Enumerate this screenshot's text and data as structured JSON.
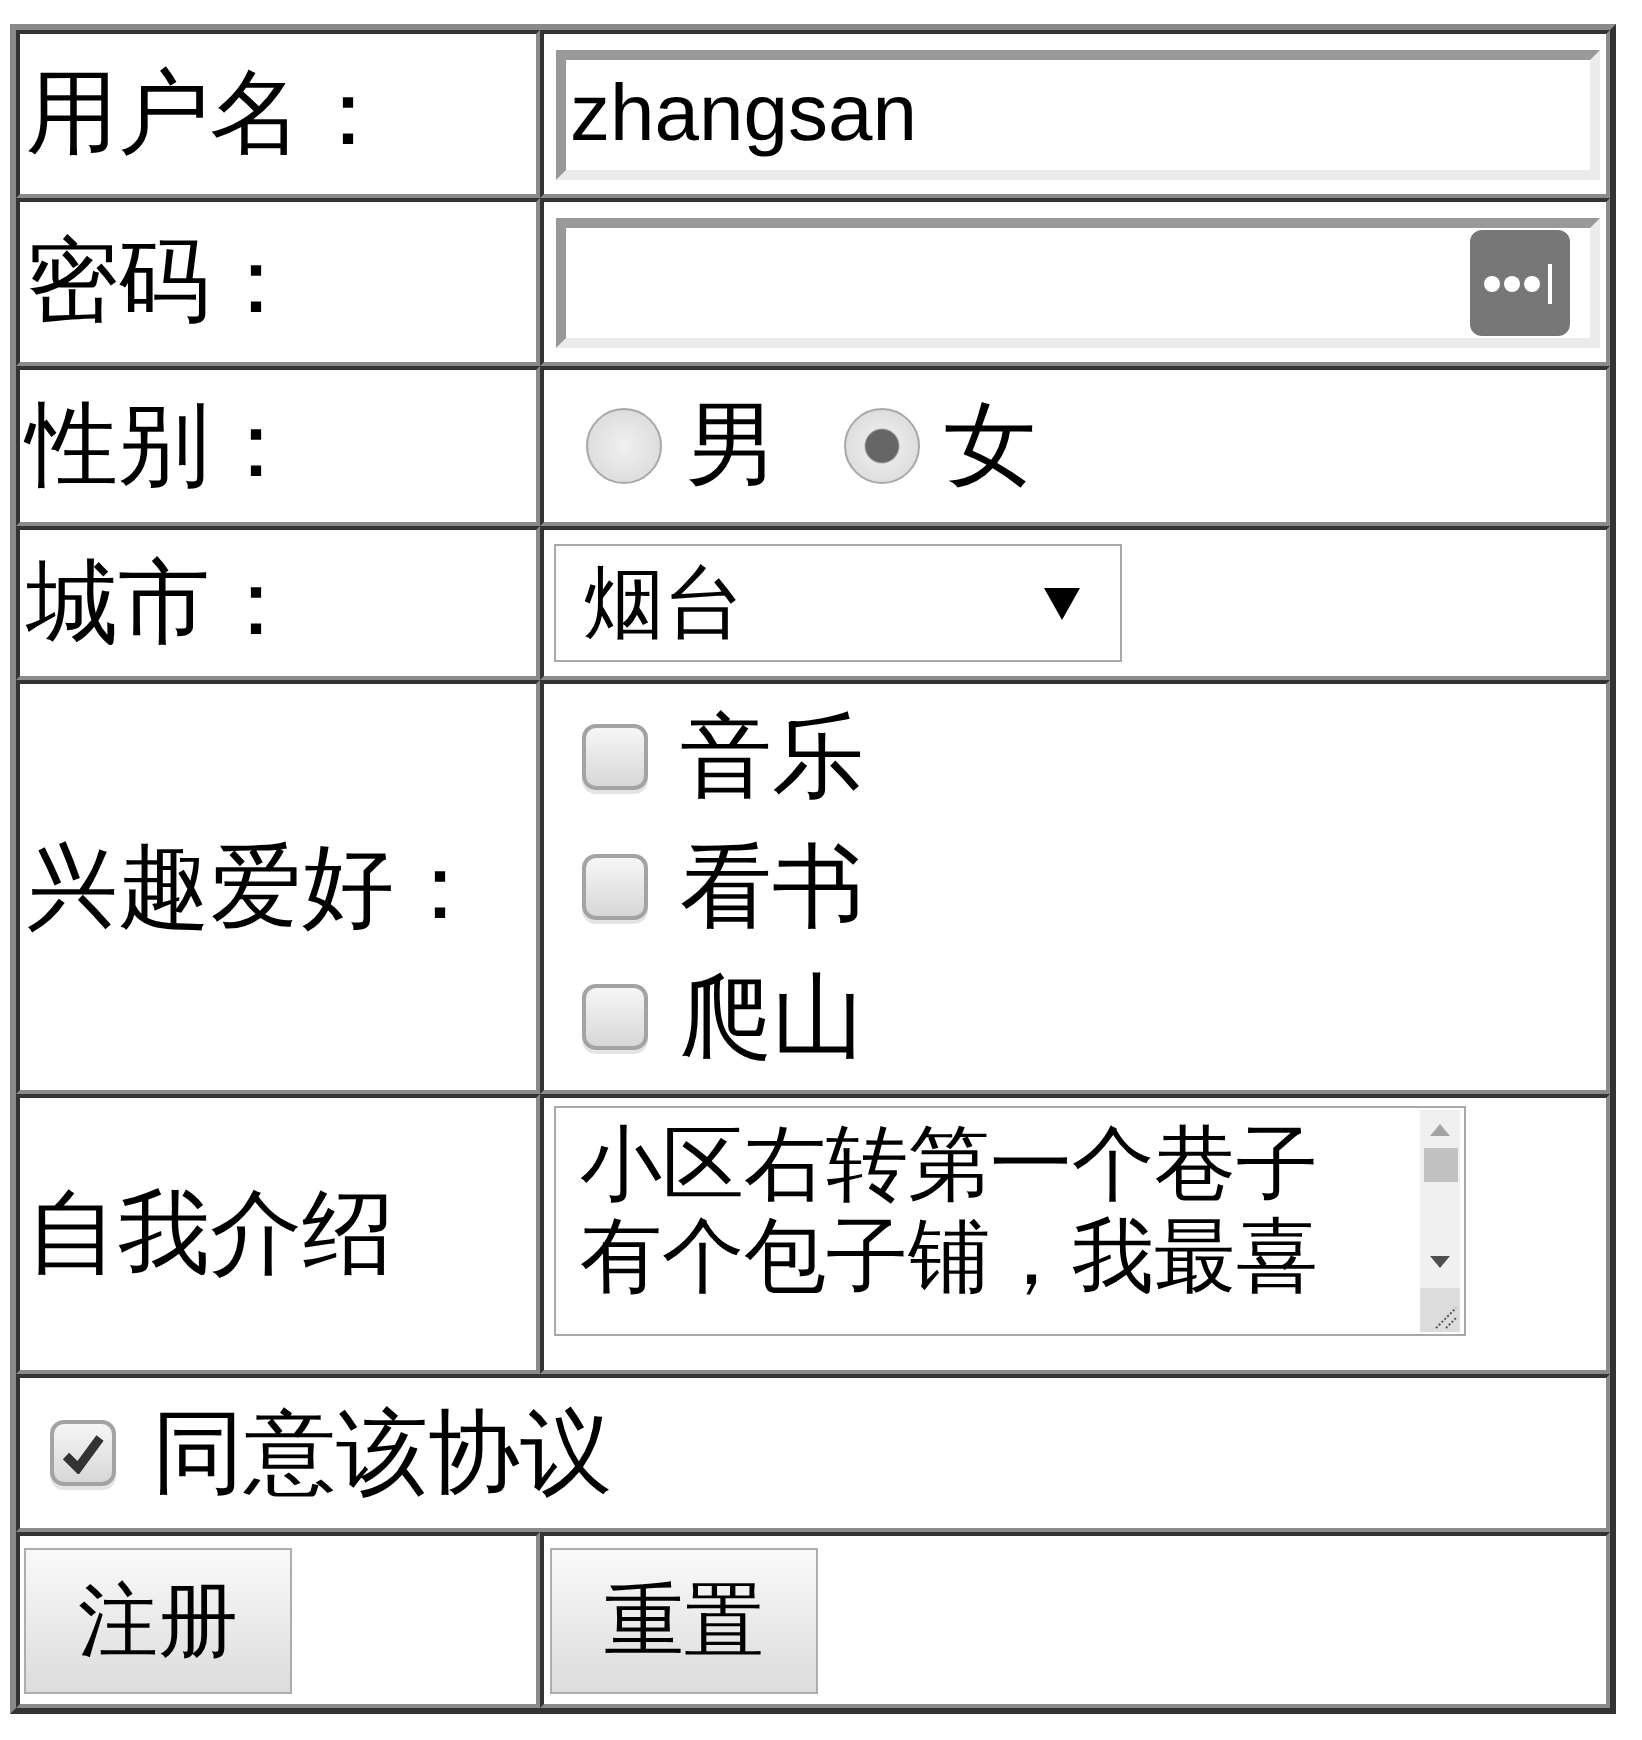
{
  "form": {
    "rows": [
      {
        "kind": "text",
        "label": "用户名：",
        "value": "zhangsan"
      },
      {
        "kind": "password",
        "label": "密码："
      },
      {
        "kind": "radio",
        "label": "性别：",
        "options": [
          {
            "label": "男",
            "selected": false
          },
          {
            "label": "女",
            "selected": true
          }
        ]
      },
      {
        "kind": "select",
        "label": "城市：",
        "value": "烟台"
      },
      {
        "kind": "checkboxes",
        "label": "兴趣爱好：",
        "options": [
          {
            "label": "音乐",
            "checked": false
          },
          {
            "label": "看书",
            "checked": false
          },
          {
            "label": "爬山",
            "checked": false
          }
        ]
      },
      {
        "kind": "textarea",
        "label": "自我介绍",
        "value": "小区右转第一个巷子有个包子铺，我最喜"
      },
      {
        "kind": "agreement",
        "label": "同意该协议",
        "checked": true
      },
      {
        "kind": "buttons",
        "buttons": [
          {
            "label": "注册"
          },
          {
            "label": "重置"
          }
        ]
      }
    ]
  }
}
